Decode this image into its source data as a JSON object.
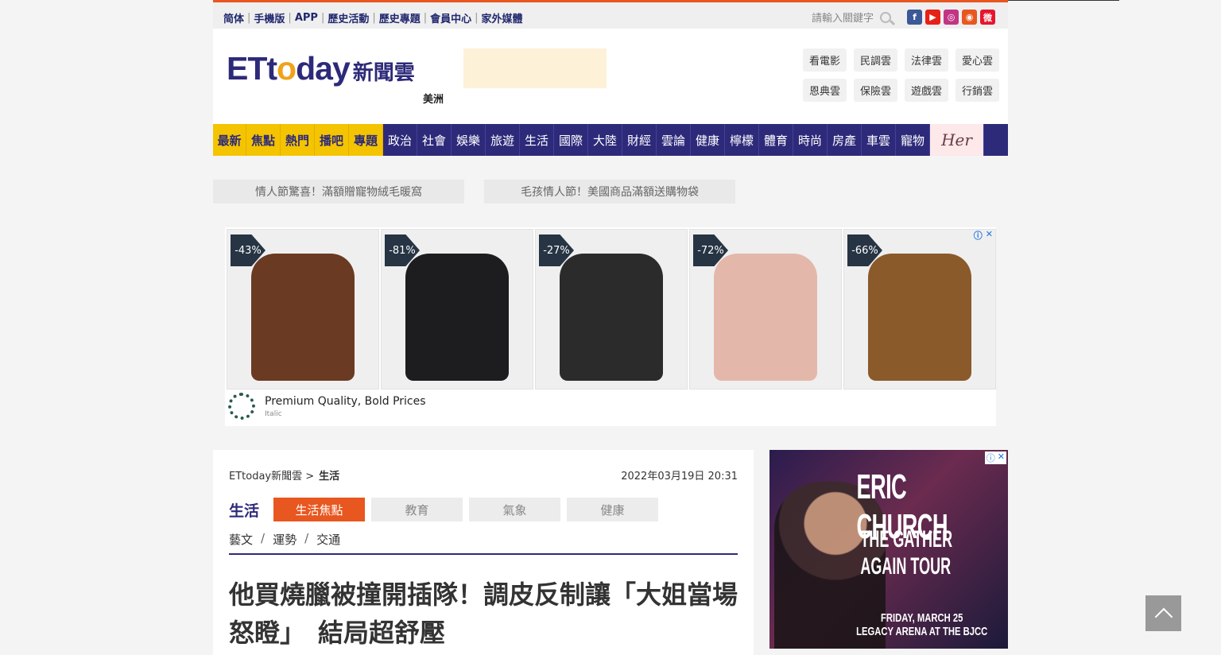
{
  "topbar": {
    "links": [
      "简体",
      "手機版",
      "APP",
      "歷史活動",
      "歷史專題",
      "會員中心",
      "家外媒體"
    ],
    "search_placeholder": "請輸入關鍵字",
    "social": [
      {
        "name": "facebook-icon",
        "glyph": "f",
        "color": "#3b5998"
      },
      {
        "name": "youtube-icon",
        "glyph": "▶",
        "color": "#e62117"
      },
      {
        "name": "instagram-icon",
        "glyph": "◎",
        "color": "#c13584"
      },
      {
        "name": "rss-icon",
        "glyph": "◉",
        "color": "#e8571f"
      },
      {
        "name": "weibo-icon",
        "glyph": "微",
        "color": "#e6162d"
      }
    ]
  },
  "header": {
    "logo_text": "ETtoday",
    "logo_cn": "新聞雲",
    "region": "美洲",
    "clouds": [
      "看電影",
      "民調雲",
      "法律雲",
      "愛心雲",
      "恩典雲",
      "保險雲",
      "遊戲雲",
      "行銷雲"
    ]
  },
  "nav": {
    "highlight": [
      "最新",
      "焦點",
      "熱門",
      "播吧",
      "專題"
    ],
    "items": [
      "政治",
      "社會",
      "娛樂",
      "旅遊",
      "生活",
      "國際",
      "大陸",
      "財經",
      "雲論",
      "健康",
      "檸檬",
      "體育",
      "時尚",
      "房產",
      "車雲",
      "寵物"
    ],
    "her_label": "Her"
  },
  "promos": [
    "情人節驚喜！滿額贈寵物絨毛暖窩",
    "毛孩情人節！美國商品滿額送購物袋"
  ],
  "ad_banner": {
    "discounts": [
      "-43%",
      "-81%",
      "-27%",
      "-72%",
      "-66%"
    ],
    "products": [
      "brown-leather-boots",
      "black-hoodie",
      "black-backpack-cooler",
      "pink-sneakers",
      "leopard-slippers"
    ],
    "title": "Premium Quality, Bold Prices",
    "brand": "Italic"
  },
  "article": {
    "breadcrumb_root": "ETtoday新聞雲 >",
    "breadcrumb_current": "生活",
    "datetime": "2022年03月19日 20:31",
    "category": "生活",
    "subtabs": [
      "生活焦點",
      "教育",
      "氣象",
      "健康"
    ],
    "sublinks": [
      "藝文",
      "運勢",
      "交通"
    ],
    "headline": "他買燒臘被撞開插隊！調皮反制讓「大姐當場怒瞪」　結局超舒壓"
  },
  "side_ad": {
    "line1": "ERIC CHURCH",
    "line2": "THE GATHER AGAIN TOUR",
    "line3": "FRIDAY, MARCH 25",
    "line4": "LEGACY ARENA AT THE BJCC"
  }
}
